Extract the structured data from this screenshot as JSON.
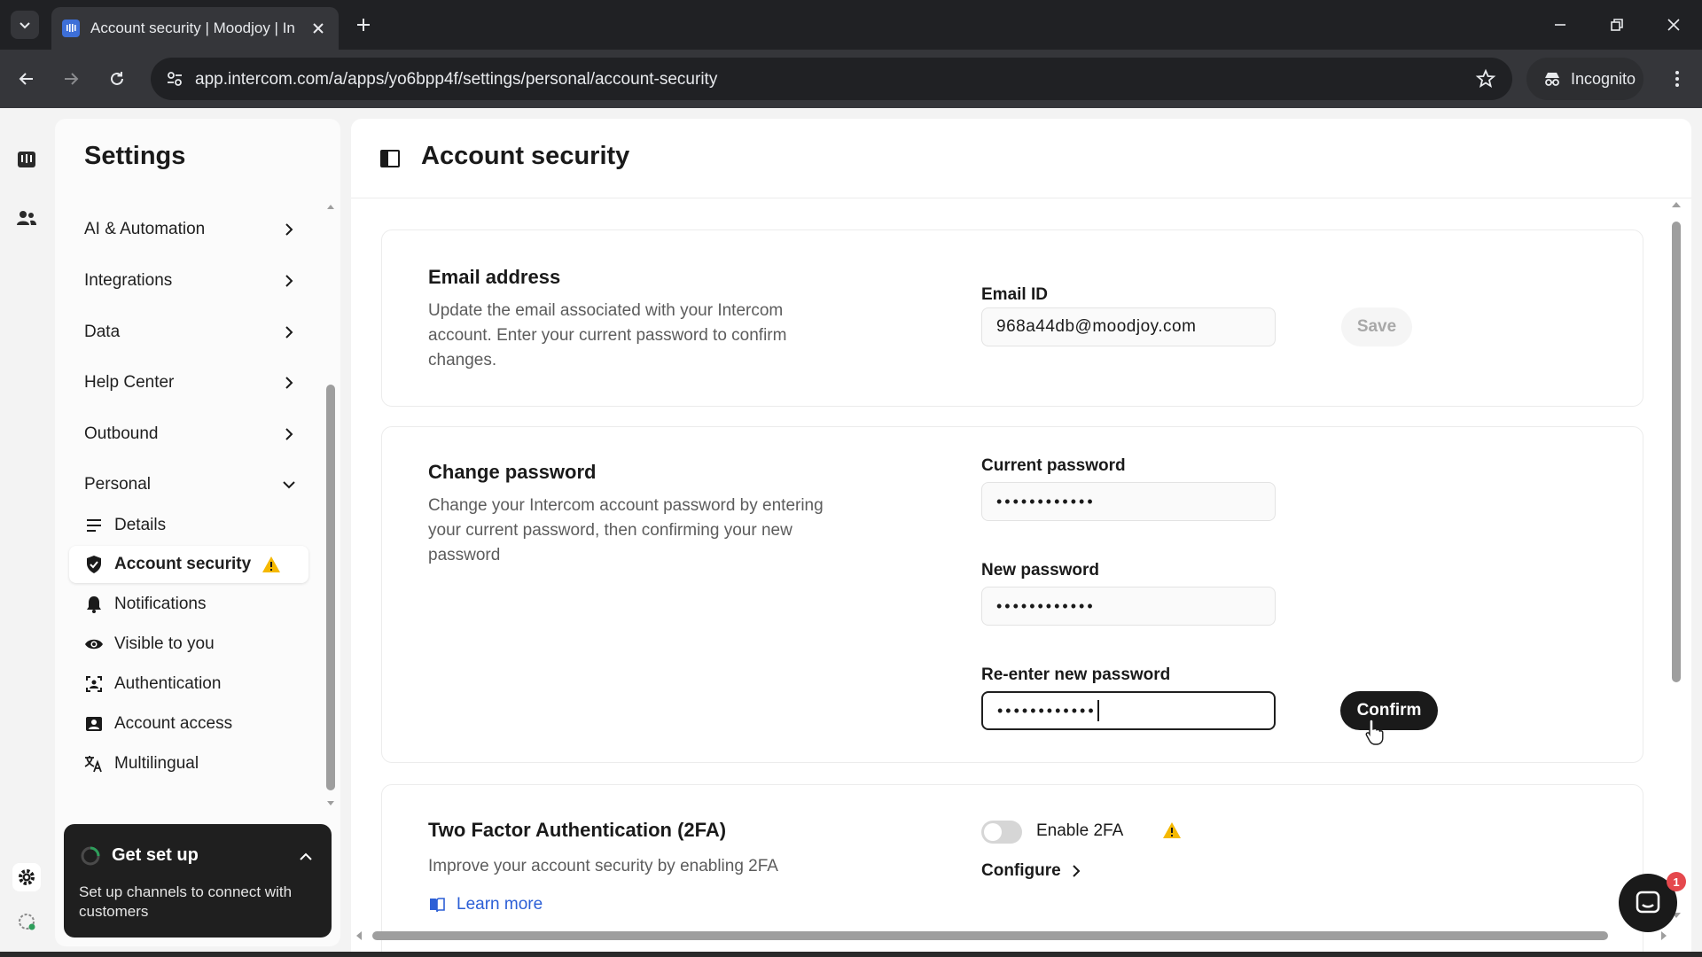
{
  "browser": {
    "tab_title": "Account security | Moodjoy | In",
    "url": "app.intercom.com/a/apps/yo6bpp4f/settings/personal/account-security",
    "incognito_label": "Incognito"
  },
  "sidebar": {
    "title": "Settings",
    "sections": [
      {
        "label": "AI & Automation"
      },
      {
        "label": "Integrations"
      },
      {
        "label": "Data"
      },
      {
        "label": "Help Center"
      },
      {
        "label": "Outbound"
      },
      {
        "label": "Personal"
      }
    ],
    "personal_items": [
      {
        "label": "Details",
        "icon": "list-icon"
      },
      {
        "label": "Account security",
        "icon": "shield-check-icon",
        "active": true,
        "warning": true
      },
      {
        "label": "Notifications",
        "icon": "bell-icon"
      },
      {
        "label": "Visible to you",
        "icon": "eye-icon"
      },
      {
        "label": "Authentication",
        "icon": "authentication-icon"
      },
      {
        "label": "Account access",
        "icon": "account-access-icon"
      },
      {
        "label": "Multilingual",
        "icon": "translate-icon"
      }
    ]
  },
  "get_set_up": {
    "title": "Get set up",
    "subtitle": "Set up channels to connect with customers"
  },
  "page": {
    "title": "Account security",
    "email_section": {
      "title": "Email address",
      "description": "Update the email associated with your Intercom account. Enter your current password to confirm changes.",
      "field_label": "Email ID",
      "email_value": "968a44db@moodjoy.com",
      "save_label": "Save"
    },
    "password_section": {
      "title": "Change password",
      "description": "Change your Intercom account password by entering your current password, then confirming your new password",
      "current_label": "Current password",
      "current_value": "••••••••••••",
      "new_label": "New password",
      "new_value": "••••••••••••",
      "reenter_label": "Re-enter new password",
      "reenter_value": "••••••••••••",
      "confirm_label": "Confirm"
    },
    "twofa_section": {
      "title": "Two Factor Authentication (2FA)",
      "description": "Improve your account security by enabling 2FA",
      "learn_more": "Learn more",
      "toggle_label": "Enable 2FA",
      "toggle_on": false,
      "configure_label": "Configure"
    }
  },
  "messenger": {
    "badge_count": "1"
  },
  "colors": {
    "accent": "#1a1a1a",
    "link": "#2c5fd6",
    "warning": "#f5b800",
    "badge": "#e5484d"
  }
}
